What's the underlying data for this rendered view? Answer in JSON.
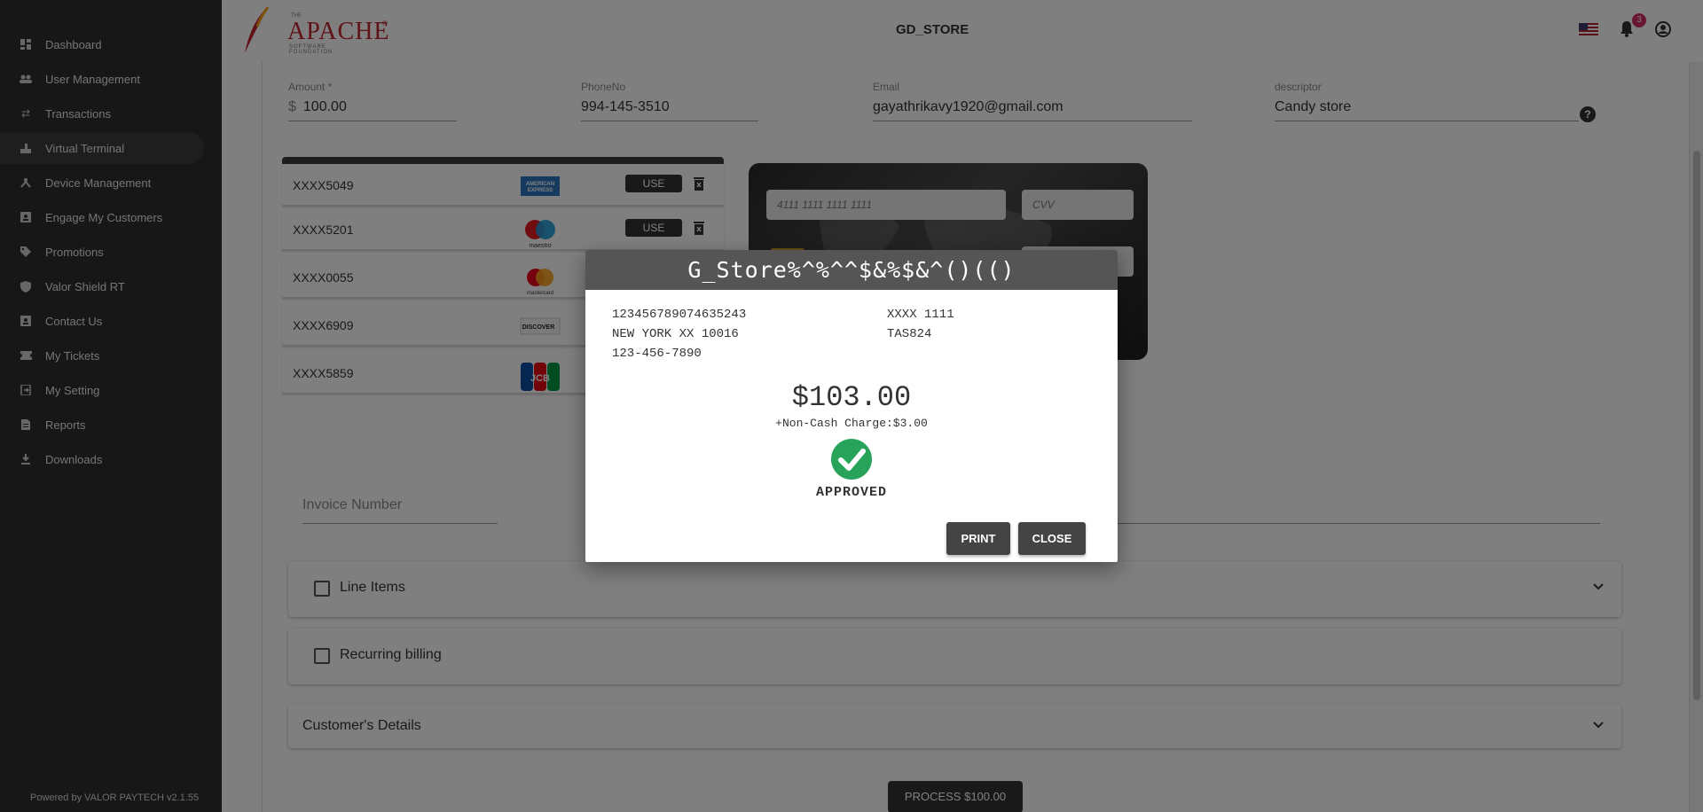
{
  "sidebar": {
    "items": [
      {
        "label": "Dashboard",
        "icon": "dashboard-icon"
      },
      {
        "label": "User Management",
        "icon": "users-icon"
      },
      {
        "label": "Transactions",
        "icon": "transfer-icon"
      },
      {
        "label": "Virtual Terminal",
        "icon": "terminal-icon"
      },
      {
        "label": "Device Management",
        "icon": "device-icon"
      },
      {
        "label": "Engage My Customers",
        "icon": "contact-card-icon"
      },
      {
        "label": "Promotions",
        "icon": "tag-icon"
      },
      {
        "label": "Valor Shield RT",
        "icon": "shield-icon"
      },
      {
        "label": "Contact Us",
        "icon": "contact-icon"
      },
      {
        "label": "My Tickets",
        "icon": "ticket-icon"
      },
      {
        "label": "My Setting",
        "icon": "settings-icon"
      },
      {
        "label": "Reports",
        "icon": "report-icon"
      },
      {
        "label": "Downloads",
        "icon": "download-icon"
      }
    ],
    "active": "Virtual Terminal",
    "powered_by": "Powered by VALOR PAYTECH v2.1.55"
  },
  "header": {
    "logo": {
      "the": "THE",
      "name": "APACHE",
      "tm": "®",
      "sub": "SOFTWARE FOUNDATION"
    },
    "title": "GD_STORE",
    "notification_count": "3"
  },
  "form": {
    "amount": {
      "label": "Amount *",
      "currency": "$",
      "value": "100.00"
    },
    "phone": {
      "label": "PhoneNo",
      "value": "994-145-3510"
    },
    "email": {
      "label": "Email",
      "value": "gayathrikavy1920@gmail.com"
    },
    "descriptor": {
      "label": "descriptor",
      "value": "Candy store"
    },
    "invoice_placeholder": "Invoice Number"
  },
  "saved_cards": [
    {
      "number": "XXXX5049",
      "brand": "amex",
      "use_label": "USE"
    },
    {
      "number": "XXXX5201",
      "brand": "maestro",
      "use_label": "USE"
    },
    {
      "number": "XXXX0055",
      "brand": "mastercard"
    },
    {
      "number": "XXXX6909",
      "brand": "discover"
    },
    {
      "number": "XXXX5859",
      "brand": "jcb"
    }
  ],
  "brand_labels": {
    "amex": "AMERICAN EXPRESS",
    "maestro": "maestro",
    "mastercard": "mastercard",
    "discover": "DISCOVER",
    "jcb": "JCB"
  },
  "card_form": {
    "number_placeholder": "4111 1111 1111 1111",
    "cvv_placeholder": "CVV"
  },
  "panels": {
    "line_items": "Line Items",
    "recurring": "Recurring billing",
    "customer": "Customer's Details"
  },
  "process_button": "PROCESS $100.00",
  "receipt": {
    "title": "G_Store%^%^^$&%$&^()(()",
    "left_lines": [
      "123456789074635243",
      "NEW YORK XX 10016",
      "123-456-7890"
    ],
    "right_lines": [
      "XXXX 1111",
      "TAS824"
    ],
    "amount": "$103.00",
    "non_cash": "+Non-Cash Charge:$3.00",
    "status": "APPROVED",
    "print_label": "PRINT",
    "close_label": "CLOSE"
  },
  "colors": {
    "sidebar_bg": "#2f2f2f",
    "accent_dark": "#333333",
    "approved_green": "#27a35a",
    "badge": "#d32f63"
  }
}
